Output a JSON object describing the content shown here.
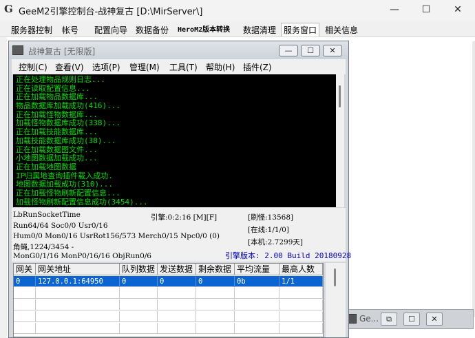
{
  "outer": {
    "logo": "G",
    "title": "GeeM2引擎控制台-战神复古 [D:\\MirServer\\]",
    "controls": {
      "minimize": "—",
      "maximize": "☐",
      "close": "✕"
    },
    "tabs": [
      {
        "label": "服务器控制",
        "active": false
      },
      {
        "label": "帐号",
        "active": false
      },
      {
        "label": "配置向导",
        "active": false
      },
      {
        "label": "数据备份",
        "active": false
      },
      {
        "label": "HeroM2版本转换",
        "active": false
      },
      {
        "label": "数据清理",
        "active": false
      },
      {
        "label": "服务窗口",
        "active": true
      },
      {
        "label": "相关信息",
        "active": false
      }
    ],
    "minimized_child": {
      "title": "Ge...",
      "restore": "⧉",
      "maximize": "☐",
      "close": "✕"
    }
  },
  "child": {
    "title": "战神复古 [无限版]",
    "controls": {
      "minimize": "—",
      "maximize": "☐",
      "close": "✕"
    },
    "menu": [
      "控制(C)",
      "查看(V)",
      "选项(P)",
      "管理(M)",
      "工具(T)",
      "帮助(H)",
      "插件(Z)"
    ],
    "log": [
      "正在处理物品规则日志...",
      "正在读取配置信息...",
      "正在加载物品数据库...",
      "物品数据库加载成功(416)...",
      "正在加载怪物数据库...",
      "加载怪物数据库成功(338)...",
      "正在加载技能数据库...",
      "加载技能数据库成功(38)...",
      "正在加载数据图文件...",
      "小地图数据加载成功...",
      "正在加载地图数据",
      "IP归属地查询插件载入成功.",
      "地图数据加载成功(310)...",
      "正在加载怪物刷新配置信息...",
      "加载怪物刷新配置信息成功(3454)..."
    ],
    "status": {
      "socket": "LbRunSocketTime",
      "engine": "引擎:0:2:16 [M][F]",
      "refresh": "[刷怪:13568]",
      "run": "Run64/64 Soc0/0 Usr0/16",
      "online": "[在线:1/1/0]",
      "hum": "Hum0/0 Mon0/16 UsrRot156/573 Merch0/15 Npc0/0 (0)",
      "uptime": "[本机:2.7299天]",
      "monster": "角蝇,1224/3454 -",
      "mong": "MonG0/1/16 MonP0/16/16 ObjRun0/6",
      "version": "引擎版本: 2.00 Build 20180928"
    },
    "table": {
      "columns": [
        "网关",
        "网关地址",
        "队列数据",
        "发送数据",
        "剩余数据",
        "平均流量",
        "最高人数"
      ],
      "rows": [
        {
          "cells": [
            "0",
            "127.0.0.1:64950",
            "0",
            "0",
            "0",
            "0b",
            "1/1"
          ],
          "selected": true
        },
        {
          "cells": [
            "",
            "",
            "",
            "",
            "",
            "",
            ""
          ],
          "selected": false
        },
        {
          "cells": [
            "",
            "",
            "",
            "",
            "",
            "",
            ""
          ],
          "selected": false
        },
        {
          "cells": [
            "",
            "",
            "",
            "",
            "",
            "",
            ""
          ],
          "selected": false
        },
        {
          "cells": [
            "",
            "",
            "",
            "",
            "",
            "",
            ""
          ],
          "selected": false
        }
      ]
    }
  }
}
